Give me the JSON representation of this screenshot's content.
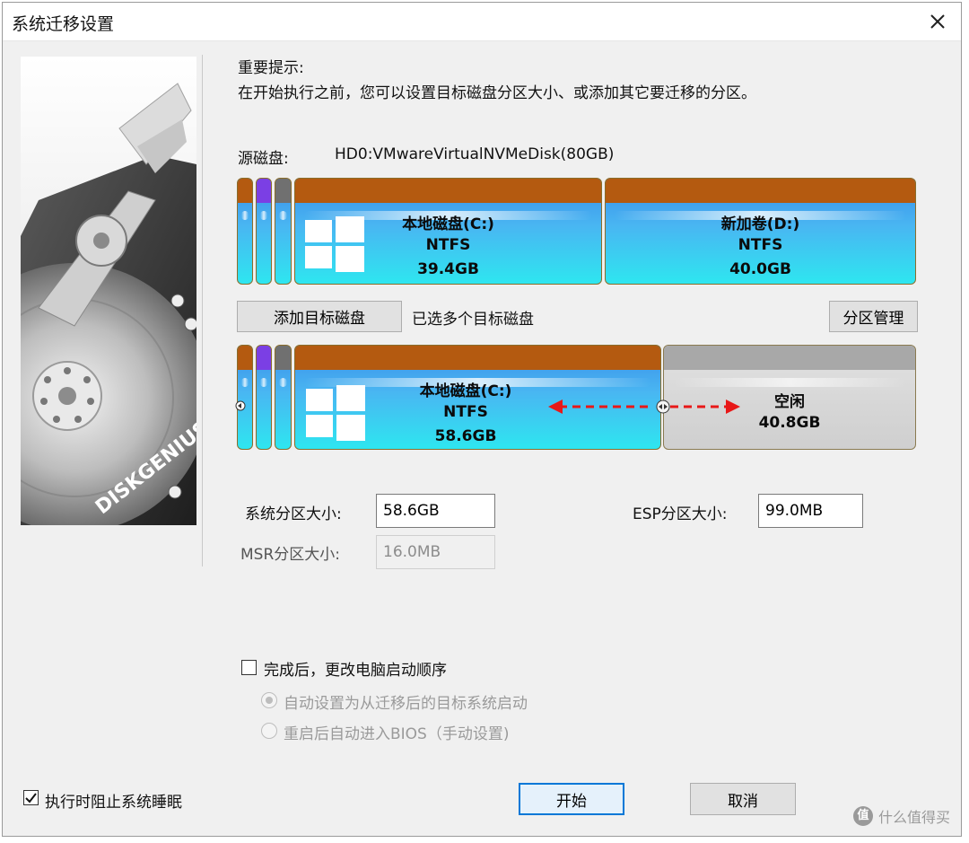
{
  "window": {
    "title": "系统迁移设置"
  },
  "side_image": {
    "brand": "DISKGENIUS"
  },
  "hint": {
    "title": "重要提示:",
    "body": "在开始执行之前，您可以设置目标磁盘分区大小、或添加其它要迁移的分区。"
  },
  "source": {
    "label": "源磁盘:",
    "value": "HD0:VMwareVirtualNVMeDisk(80GB)",
    "partitions": [
      {
        "name": "本地磁盘(C:)",
        "fs": "NTFS",
        "size": "39.4GB"
      },
      {
        "name": "新加卷(D:)",
        "fs": "NTFS",
        "size": "40.0GB"
      }
    ]
  },
  "target": {
    "add_button": "添加目标磁盘",
    "selected_text": "已选多个目标磁盘",
    "manage_button": "分区管理",
    "partitions": [
      {
        "name": "本地磁盘(C:)",
        "fs": "NTFS",
        "size": "58.6GB"
      },
      {
        "name": "空闲",
        "size": "40.8GB"
      }
    ]
  },
  "fields": {
    "system_label": "系统分区大小:",
    "system_value": "58.6GB",
    "esp_label": "ESP分区大小:",
    "esp_value": "99.0MB",
    "msr_label": "MSR分区大小:",
    "msr_value": "16.0MB"
  },
  "boot": {
    "checkbox_label": "完成后，更改电脑启动顺序",
    "option1": "自动设置为从迁移后的目标系统启动",
    "option2": "重启后自动进入BIOS（手动设置)"
  },
  "footer": {
    "prevent_sleep": "执行时阻止系统睡眠",
    "start": "开始",
    "cancel": "取消"
  },
  "watermark": {
    "icon_text": "值",
    "text": "什么值得买"
  },
  "colors": {
    "partition_cap": "#b45a10",
    "partition_fill_top": "#3a8de8",
    "partition_fill_bottom": "#2ee6f0",
    "free_space": "#d6d6d6",
    "arrow": "#e81818",
    "focus_border": "#0078d7"
  }
}
